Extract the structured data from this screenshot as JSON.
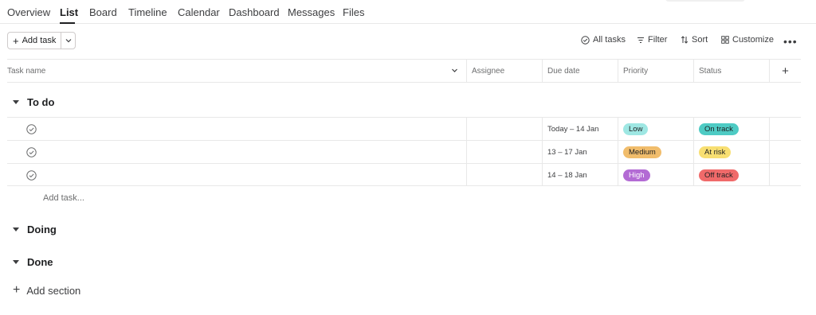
{
  "tabs": [
    {
      "label": "Overview"
    },
    {
      "label": "List"
    },
    {
      "label": "Board"
    },
    {
      "label": "Timeline"
    },
    {
      "label": "Calendar"
    },
    {
      "label": "Dashboard"
    },
    {
      "label": "Messages"
    },
    {
      "label": "Files"
    }
  ],
  "active_tab": "List",
  "toolbar": {
    "add_task_label": "Add task",
    "all_tasks_label": "All tasks",
    "filter_label": "Filter",
    "sort_label": "Sort",
    "customize_label": "Customize",
    "more_label": "•••"
  },
  "columns": {
    "task_name": "Task name",
    "assignee": "Assignee",
    "due_date": "Due date",
    "priority": "Priority",
    "status": "Status"
  },
  "sections": [
    {
      "name": "To do",
      "tasks": [
        {
          "name": "",
          "assignee": "",
          "due_date": "Today – 14 Jan",
          "priority": "Low",
          "status": "On track"
        },
        {
          "name": "",
          "assignee": "",
          "due_date": "13 – 17 Jan",
          "priority": "Medium",
          "status": "At risk"
        },
        {
          "name": "",
          "assignee": "",
          "due_date": "14 – 18 Jan",
          "priority": "High",
          "status": "Off track"
        }
      ]
    },
    {
      "name": "Doing",
      "tasks": []
    },
    {
      "name": "Done",
      "tasks": []
    }
  ],
  "add_task_inline_label": "Add task...",
  "add_section_label": "Add section",
  "colors": {
    "priority_low": "#9ee7e3",
    "priority_medium": "#f1bd6c",
    "priority_high": "#b36bd4",
    "status_on_track": "#4ecbc4",
    "status_at_risk": "#f8df72",
    "status_off_track": "#f06a6a"
  }
}
